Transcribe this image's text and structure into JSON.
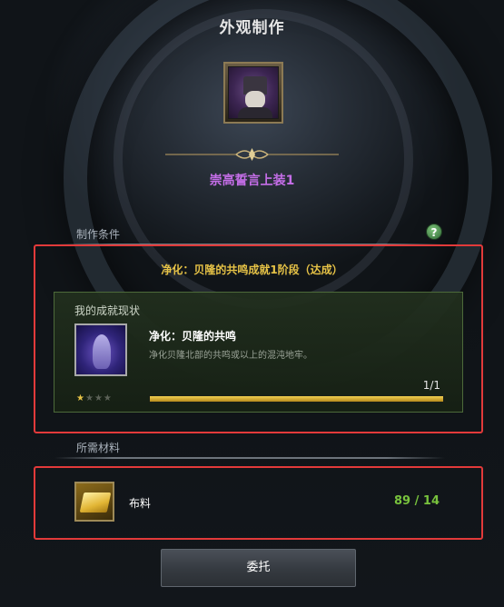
{
  "window": {
    "title": "外观制作"
  },
  "item": {
    "name": "崇高誓言上装1"
  },
  "conditions": {
    "section_label": "制作条件",
    "help_label": "?",
    "requirement": "净化：贝隆的共鸣成就1阶段（达成）",
    "achievement": {
      "panel_title": "我的成就现状",
      "name": "净化：贝隆的共鸣",
      "description": "净化贝隆北部的共鸣或以上的混沌地牢。",
      "stars_filled": 1,
      "stars_total": 4,
      "progress_text": "1/1",
      "progress_fraction": 1.0
    }
  },
  "materials": {
    "section_label": "所需材料",
    "items": [
      {
        "name": "布料",
        "count": "89 / 14",
        "icon": "cloth-icon"
      }
    ]
  },
  "actions": {
    "commission_label": "委托"
  },
  "colors": {
    "item_name": "#c56ee8",
    "requirement_text": "#e6c246",
    "highlight_box": "#e23a3a",
    "material_count": "#78c23d",
    "progress_fill": "#e6c246"
  }
}
